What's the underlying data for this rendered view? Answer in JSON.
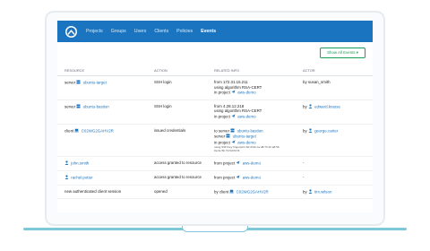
{
  "nav": {
    "items": [
      "Projects",
      "Groups",
      "Users",
      "Clients",
      "Policies",
      "Events"
    ],
    "active_index": 5
  },
  "toolbar": {
    "show_events": "Show All Events ▾"
  },
  "table": {
    "headers": [
      "RESOURCE",
      "ACTION",
      "RELATED INFO",
      "ACTOR"
    ],
    "rows": [
      {
        "resource_prefix": "server",
        "resource_name": "ubuntu-target",
        "resource_icon": "server-icon",
        "action": "SSH login",
        "info_lines": [
          "from 172.31.15.211",
          "using algorithm RSA-CERT"
        ],
        "info_project_prefix": "in project",
        "info_project": "aws-demo",
        "actor_prefix": "by",
        "actor": "susan_smith"
      },
      {
        "resource_prefix": "server",
        "resource_name": "ubuntu-bastion",
        "resource_icon": "server-icon",
        "action": "SSH login",
        "info_lines": [
          "from 4.28.12.218",
          "using algorithm RSA-CERT"
        ],
        "info_project_prefix": "in project",
        "info_project": "aws-demo",
        "actor_prefix": "by",
        "actor": "edward.krause"
      },
      {
        "resource_prefix": "client",
        "resource_name": "C02WG2GAHV2R",
        "resource_icon": "laptop-icon",
        "action": "issued credentials",
        "info_server1_prefix": "to server",
        "info_server1": "ubuntu-bastion",
        "info_server2_prefix": "server",
        "info_server2": "ubuntu-target",
        "info_project_prefix": "in project",
        "info_project": "aws-demo",
        "info_fp1": "using SSH key fingerprint 60:3f:2b:ca:d8:7b:1b:a8:96",
        "info_fp2": "0a:3e:5b:72:6d:63:f3",
        "actor_prefix": "by",
        "actor": "george.carter"
      },
      {
        "resource_name": "john.smith",
        "resource_icon": "user-icon",
        "action": "access granted to resource",
        "info_project_prefix": "from project",
        "info_project": "aws-demo",
        "actor": "-"
      },
      {
        "resource_name": "rachel.potter",
        "resource_icon": "user-icon",
        "action": "access granted to resource",
        "info_project_prefix": "from project",
        "info_project": "aws-demo",
        "actor": "-"
      },
      {
        "resource_text": "new authenticated client session",
        "action": "opened",
        "info_client_prefix": "by client",
        "info_client": "C02WG2GAHV2R",
        "actor_prefix": "by",
        "actor": "tim.wilson"
      }
    ]
  },
  "colors": {
    "brand": "#1a74bf",
    "accent_green": "#1a9e5a",
    "screen_border": "#e6ebef",
    "base": "#7ec8d9"
  }
}
